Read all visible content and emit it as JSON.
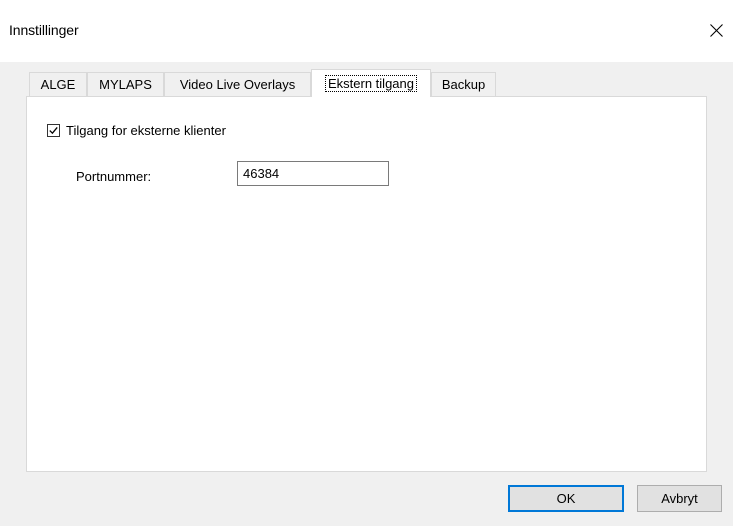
{
  "window": {
    "title": "Innstillinger",
    "close_icon": "close-icon"
  },
  "tabs": [
    {
      "label": "ALGE",
      "active": false
    },
    {
      "label": "MYLAPS",
      "active": false
    },
    {
      "label": "Video Live Overlays",
      "active": false
    },
    {
      "label": "Ekstern tilgang",
      "active": true
    },
    {
      "label": "Backup",
      "active": false
    }
  ],
  "panel": {
    "external_access": {
      "checkbox_label": "Tilgang for eksterne klienter",
      "checked": true
    },
    "port": {
      "label": "Portnummer:",
      "value": "46384"
    }
  },
  "buttons": {
    "ok": "OK",
    "cancel": "Avbryt"
  },
  "colors": {
    "accent": "#0078d7",
    "panel_bg": "#ffffff",
    "window_bg": "#f0f0f0"
  }
}
